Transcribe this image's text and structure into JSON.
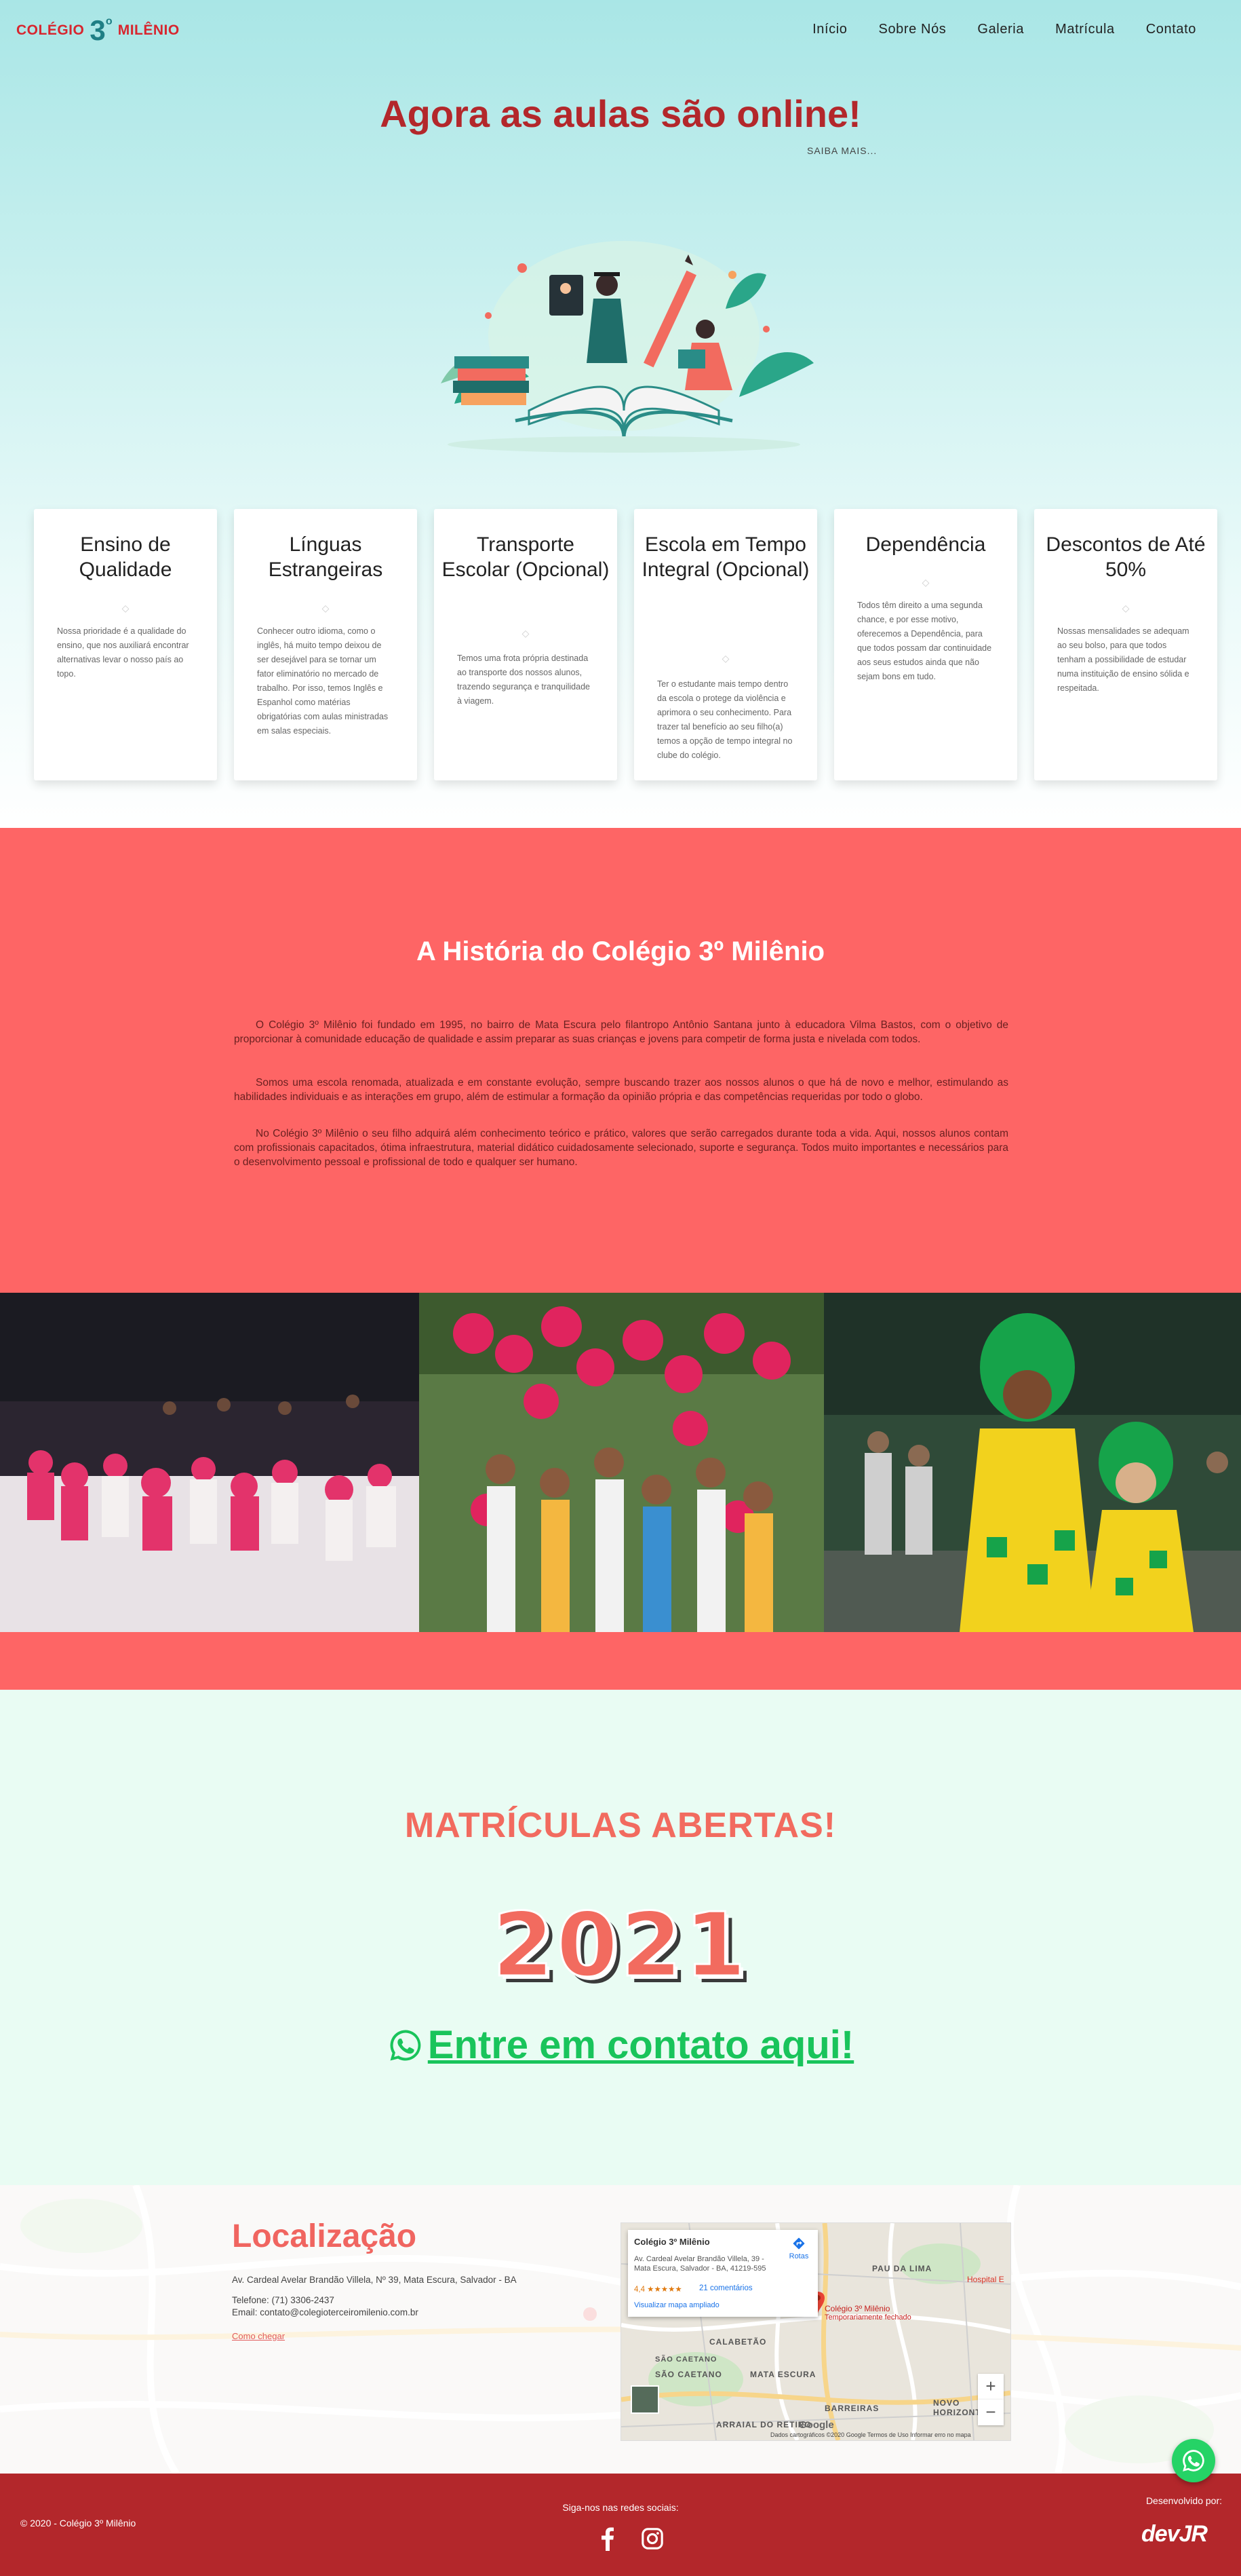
{
  "brand": {
    "name_left": "COLÉGIO",
    "number": "3",
    "sup": "o",
    "name_right": "MILÊNIO"
  },
  "nav": {
    "items": [
      "Início",
      "Sobre Nós",
      "Galeria",
      "Matrícula",
      "Contato"
    ]
  },
  "hero": {
    "title": "Agora as aulas são online!",
    "more": "SAIBA MAIS..."
  },
  "cards": [
    {
      "title": "Ensino de Qualidade",
      "text": "Nossa prioridade é a qualidade do ensino, que nos auxiliará encontrar alternativas levar o nosso país ao topo."
    },
    {
      "title": "Línguas Estrangeiras",
      "text": "Conhecer outro idioma, como o inglês, há muito tempo deixou de ser desejável para se tornar um fator eliminatório no mercado de trabalho. Por isso, temos Inglês e Espanhol como matérias obrigatórias com aulas ministradas em salas especiais."
    },
    {
      "title": "Transporte Escolar (Opcional)",
      "text": "Temos uma frota própria destinada ao transporte dos nossos alunos, trazendo segurança e tranquilidade à viagem."
    },
    {
      "title": "Escola em Tempo Integral (Opcional)",
      "text": "Ter o estudante mais tempo dentro da escola o protege da violência e aprimora o seu conhecimento. Para trazer tal benefício ao seu filho(a) temos a opção de tempo integral no clube do colégio."
    },
    {
      "title": "Dependência",
      "text": "Todos têm direito a uma segunda chance, e por esse motivo, oferecemos a Dependência, para que todos possam dar continuidade aos seus estudos ainda que não sejam bons em tudo."
    },
    {
      "title": "Descontos de Até 50%",
      "text": "Nossas mensalidades se adequam ao seu bolso, para que todos tenham a possibilidade de estudar numa instituição de ensino sólida e respeitada."
    }
  ],
  "history": {
    "title": "A História do Colégio 3º Milênio",
    "paragraphs": [
      "O Colégio 3º Milênio foi fundado em 1995, no bairro de Mata Escura pelo filantropo Antônio Santana junto à educadora Vilma Bastos, com o objetivo de proporcionar à comunidade educação de qualidade e assim preparar as suas crianças e jovens para competir de forma justa e nivelada com todos.",
      "Somos uma escola renomada, atualizada e em constante evolução, sempre buscando trazer aos nossos alunos o que há de novo e melhor, estimulando as habilidades individuais e as interações em grupo, além de estimular a formação da opinião própria e das competências requeridas por todo o globo.",
      "No Colégio 3º Milênio o seu filho adquirá além conhecimento teórico e prático, valores que serão carregados durante toda a vida. Aqui, nossos alunos contam com profissionais capacitados, ótima infraestrutura, material didático cuidadosamente selecionado, suporte e segurança. Todos muito importantes e necessários para o desenvolvimento pessoal e profissional de todo e qualquer ser humano."
    ]
  },
  "enroll": {
    "title": "MATRÍCULAS ABERTAS!",
    "year": "2021",
    "link": "Entre em contato aqui!"
  },
  "location": {
    "title": "Localização",
    "address": "Av. Cardeal Avelar Brandão Villela, Nº 39, Mata Escura, Salvador - BA",
    "phone": "Telefone: (71) 3306-2437",
    "email": "Email: contato@colegioterceiromilenio.com.br",
    "route": "Como chegar"
  },
  "map": {
    "place": "Colégio 3º Milênio",
    "address": "Av. Cardeal Avelar Brandão Villela, 39 - Mata Escura, Salvador - BA, 41219-595",
    "rating": "4,4 ★★★★★",
    "reviews": "21 comentários",
    "bigger": "Visualizar mapa ampliado",
    "routes": "Rotas",
    "pin_name": "Colégio 3º Milênio",
    "pin_status": "Temporariamente fechado",
    "labels": [
      "PAU DA LIMA",
      "CALABETÃO",
      "SÃO CAETANO",
      "MATA ESCURA",
      "BARREIRAS",
      "ARRAIAL DO RETIRO",
      "NOVO HORIZONTE",
      "SÃO CAETANO"
    ],
    "hospital": "Hospital E",
    "google": "Google",
    "attribution": "Dados cartográficos ©2020 Google   Termos de Uso   Informar erro no mapa"
  },
  "footer": {
    "copyright": "© 2020 - Colégio 3º Milênio",
    "social_label": "Siga-nos nas redes sociais:",
    "dev_label": "Desenvolvido por:",
    "dev_logo": "devJR"
  },
  "colors": {
    "brand_red": "#b3272b",
    "coral": "#fe6565",
    "mint": "#e9fcf3",
    "whatsapp_green": "#25d366"
  }
}
